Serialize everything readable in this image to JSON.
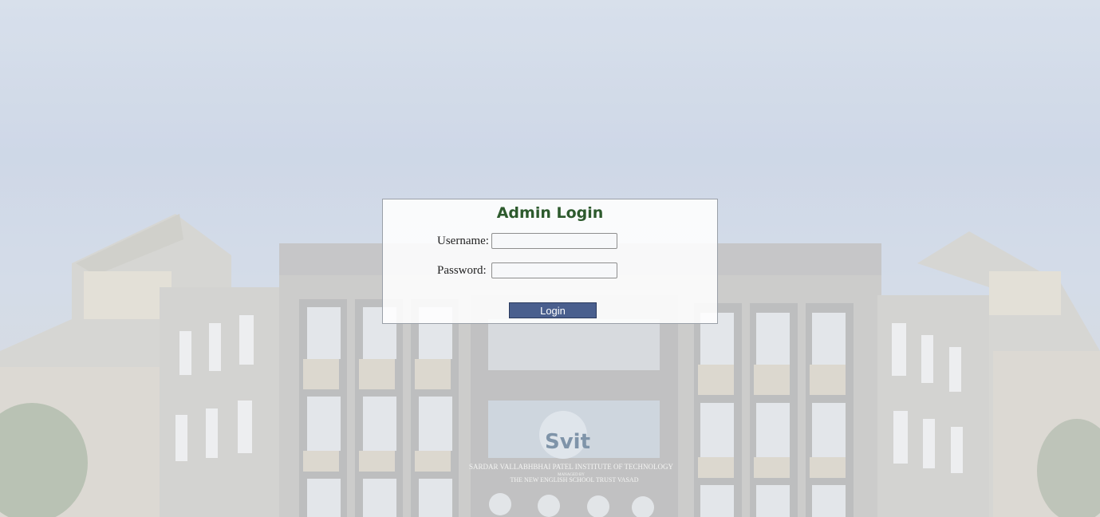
{
  "login": {
    "title": "Admin Login",
    "username_label": "Username:",
    "username_value": "",
    "password_label": "Password:",
    "password_value": "",
    "button_label": "Login"
  },
  "background": {
    "sign_line1": "SARDAR VALLABHBHAI PATEL INSTITUTE OF TECHNOLOGY",
    "sign_line2": "MANAGED BY",
    "sign_line3": "THE NEW ENGLISH SCHOOL TRUST VASAD",
    "logo_text": "Svit"
  },
  "colors": {
    "title": "#2d5a2d",
    "button": "#4a5f8e"
  }
}
